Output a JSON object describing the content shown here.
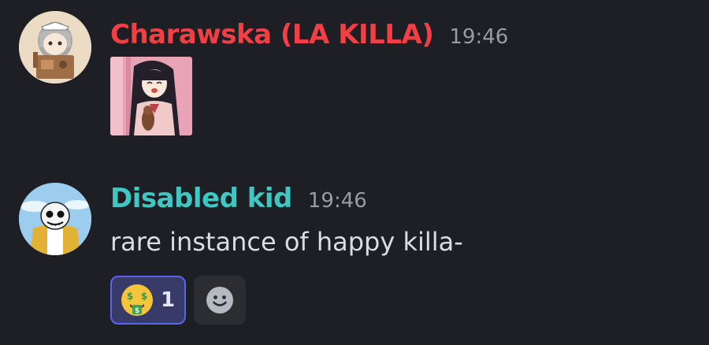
{
  "messages": [
    {
      "username": "Charawska (LA KILLA)",
      "username_color": "#f23f43",
      "timestamp": "19:46",
      "avatar": "gray-haired-anime-girl-avatar",
      "attachment": "anime-girl-smiling-image"
    },
    {
      "username": "Disabled kid",
      "username_color": "#3fc7c4",
      "timestamp": "19:46",
      "avatar": "skeleton-character-avatar",
      "text": "rare instance of happy killa-",
      "reactions": [
        {
          "emoji": "money-mouth-face",
          "count": "1",
          "active": true
        }
      ],
      "add_reaction_icon": "add-reaction-smiley-icon"
    }
  ],
  "colors": {
    "background": "#1e1f24",
    "reaction_active_bg": "#383a68",
    "reaction_active_border": "#5865f2",
    "add_reaction_bg": "#2b2d31"
  }
}
